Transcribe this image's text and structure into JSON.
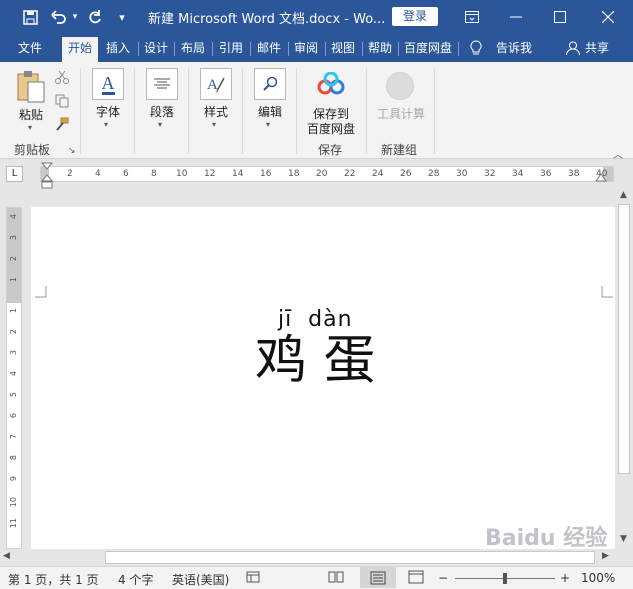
{
  "titlebar": {
    "title": "新建 Microsoft Word 文档.docx  -  Wo...",
    "login_label": "登录",
    "save_icon": "save-icon",
    "undo_icon": "undo-icon",
    "redo_icon": "redo-icon",
    "customize_icon": "customize-qat-icon"
  },
  "tabs": [
    "文件",
    "开始",
    "插入",
    "设计",
    "布局",
    "引用",
    "邮件",
    "审阅",
    "视图",
    "帮助",
    "百度网盘"
  ],
  "active_tab": "开始",
  "tell_me": "告诉我",
  "share": "共享",
  "ribbon": {
    "paste_label": "粘贴",
    "clipboard_group": "剪贴板",
    "font_label": "字体",
    "paragraph_label": "段落",
    "styles_label": "样式",
    "editing_label": "编辑",
    "save_baidu_line1": "保存到",
    "save_baidu_line2": "百度网盘",
    "save_group": "保存",
    "tools_label": "工具计算",
    "newgroup_label": "新建组"
  },
  "ruler": {
    "tab_selector": "L",
    "h_ticks": [
      "2",
      "4",
      "6",
      "8",
      "10",
      "12",
      "14",
      "16",
      "18",
      "20",
      "22",
      "24",
      "26",
      "28",
      "30",
      "32",
      "34",
      "36",
      "38",
      "40"
    ],
    "v_ticks": [
      "4",
      "3",
      "2",
      "1",
      "1",
      "2",
      "3",
      "4",
      "5",
      "6",
      "7",
      "8",
      "9",
      "10",
      "11"
    ]
  },
  "document": {
    "pinyin": "jī  dàn",
    "hanzi": "鸡 蛋"
  },
  "status": {
    "page": "第 1 页，共 1 页",
    "words": "4 个字",
    "language": "英语(美国)",
    "zoom": "100%",
    "zoom_minus": "−",
    "zoom_plus": "+"
  },
  "watermark": "Baidu 经验",
  "colors": {
    "brand": "#2b579a",
    "ribbon": "#f3f3f3"
  }
}
